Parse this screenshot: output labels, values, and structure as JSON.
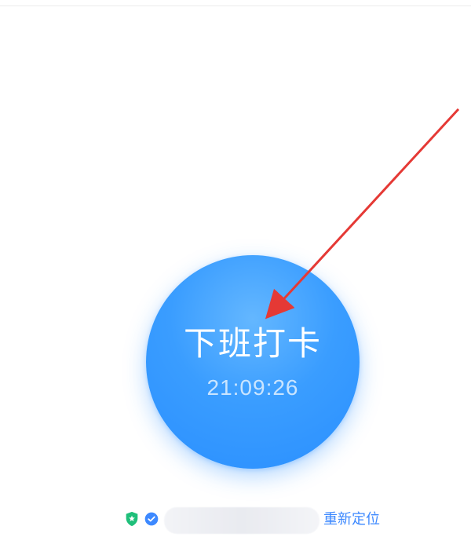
{
  "punch": {
    "label": "下班打卡",
    "time": "21:09:26"
  },
  "location": {
    "relocate_label": "重新定位"
  },
  "icons": {
    "security": "shield-icon",
    "verified": "check-circle-icon",
    "annotation": "arrow-icon"
  },
  "colors": {
    "primary": "#2a8fff",
    "link": "#3d89ff",
    "arrow": "#e53935",
    "security_green": "#1fbf7a"
  }
}
